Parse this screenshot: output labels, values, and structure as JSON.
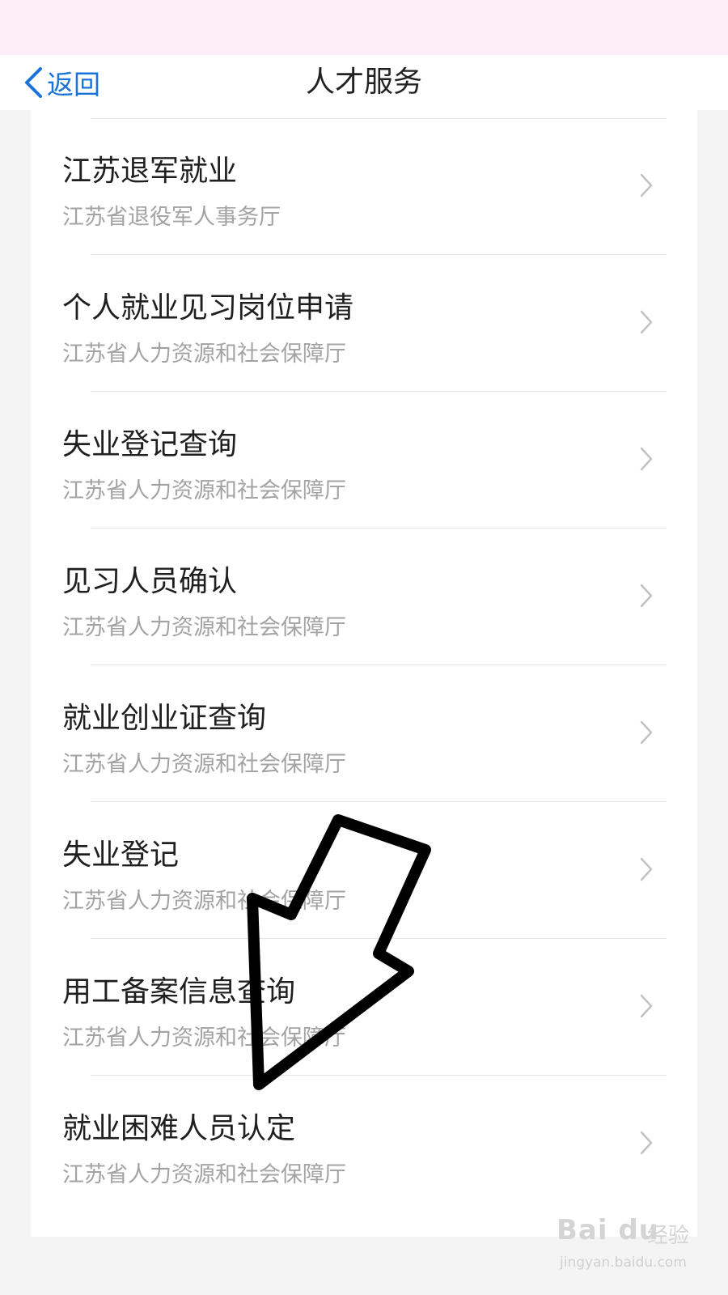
{
  "nav": {
    "back_label": "返回",
    "title": "人才服务"
  },
  "items": [
    {
      "title": "江苏退军就业",
      "subtitle": "江苏省退役军人事务厅"
    },
    {
      "title": "个人就业见习岗位申请",
      "subtitle": "江苏省人力资源和社会保障厅"
    },
    {
      "title": "失业登记查询",
      "subtitle": "江苏省人力资源和社会保障厅"
    },
    {
      "title": "见习人员确认",
      "subtitle": "江苏省人力资源和社会保障厅"
    },
    {
      "title": "就业创业证查询",
      "subtitle": "江苏省人力资源和社会保障厅"
    },
    {
      "title": "失业登记",
      "subtitle": "江苏省人力资源和社会保障厅"
    },
    {
      "title": "用工备案信息查询",
      "subtitle": "江苏省人力资源和社会保障厅"
    },
    {
      "title": "就业困难人员认定",
      "subtitle": "江苏省人力资源和社会保障厅"
    }
  ],
  "watermark": {
    "logo": "Bai du",
    "logo_suffix": "经验",
    "url": "jingyan.baidu.com"
  },
  "colors": {
    "accent": "#1a73d9",
    "arrow": "#000000"
  },
  "icons": {
    "back": "chevron-left-icon",
    "row": "chevron-right-icon",
    "annotation": "hand-drawn-arrow"
  }
}
